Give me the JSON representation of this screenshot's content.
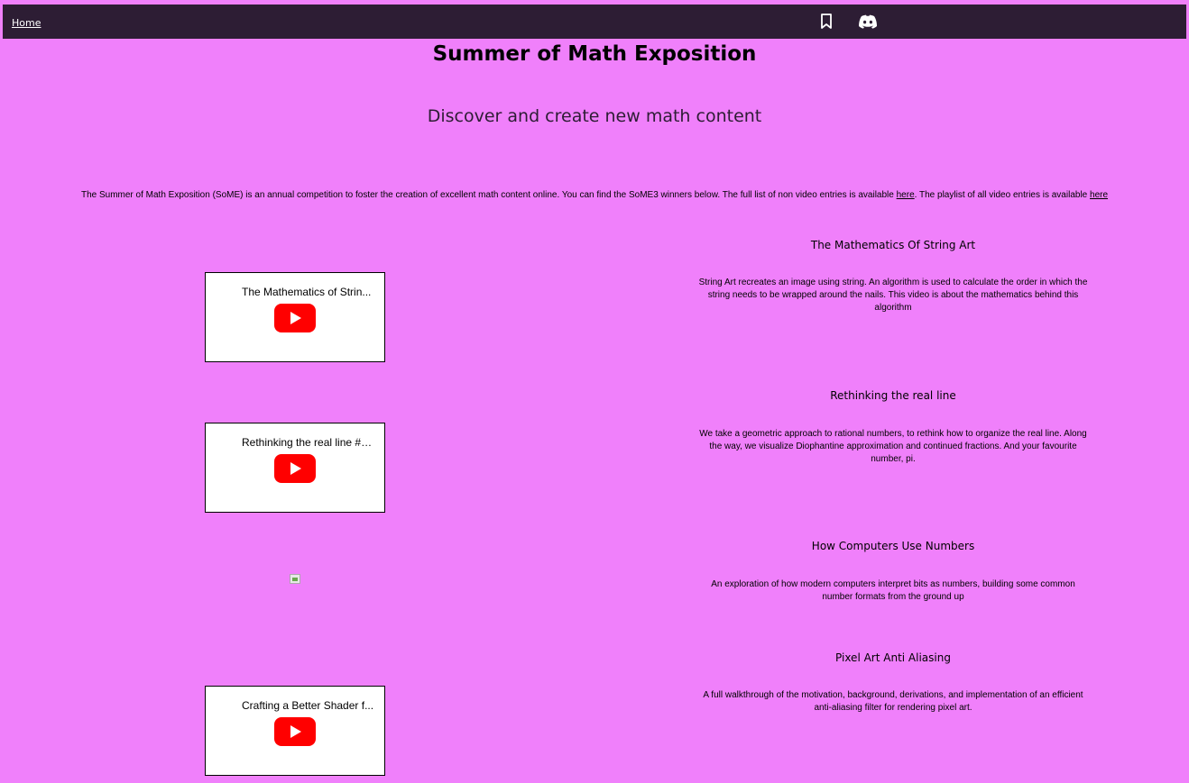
{
  "nav": {
    "home_label": "Home",
    "icons": [
      "bookmark-icon",
      "discord-icon"
    ]
  },
  "header": {
    "title": "Summer of Math Exposition",
    "subtitle": "Discover and create new math content"
  },
  "intro": {
    "text": "The Summer of Math Exposition (SoME) is an annual competition to foster the creation of excellent math content online. You can find the SoME3 winners below. The full list of non video entries is available ",
    "link1": "here",
    "middle": ". The playlist of all video entries is available ",
    "link2": "here"
  },
  "entries": [
    {
      "title": "The Mathematics Of String Art",
      "description": "String Art recreates an image using string. An algorithm is used to calculate the order in which the string needs to be wrapped around the nails. This video is about the mathematics behind this algorithm",
      "video_title": "The Mathematics of Strin..."
    },
    {
      "title": "Rethinking the real line",
      "description": "We take a geometric approach to rational numbers, to rethink how to organize the real line. Along the way, we visualize Diophantine approximation and continued fractions. And your favourite number, pi.",
      "video_title": "Rethinking the real line #S..."
    },
    {
      "title": "How Computers Use Numbers",
      "description": "An exploration of how modern computers interpret bits as numbers, building some common number formats from the ground up"
    },
    {
      "title": "Pixel Art Anti Aliasing",
      "description": "A full walkthrough of the motivation, background, derivations, and implementation of an efficient anti-aliasing filter for rendering pixel art.",
      "video_title": "Crafting a Better Shader f..."
    }
  ],
  "colors": {
    "background": "#f080fb",
    "navbar": "#2d1d34",
    "youtube_red": "#ff0000"
  }
}
